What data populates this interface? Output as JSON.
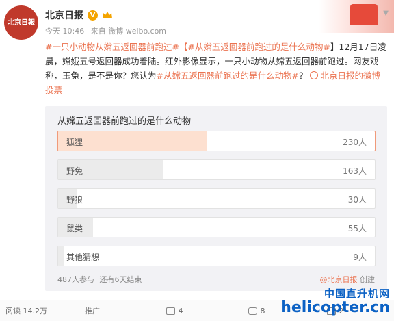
{
  "account": {
    "name": "北京日报",
    "avatar_text": "北京日報"
  },
  "meta": {
    "time": "今天 10:46",
    "source": "来自 微博 weibo.com"
  },
  "post": {
    "topic1": "#一只小动物从嫦五返回器前跑过#",
    "topic2": "【#从嫦五返回器前跑过的是什么动物#",
    "text1": "】12月17日凌晨，嫦娥五号返回器成功着陆。红外影像显示，一只小动物从嫦五返回器前跑过。网友戏称，玉兔，是不是你？您认为",
    "topic3": "#从嫦五返回器前跑过的是什么动物#",
    "text2": "？",
    "vote_link": "北京日报的微博投票"
  },
  "poll": {
    "title": "从嫦五返回器前跑过的是什么动物",
    "options": [
      {
        "label": "狐狸",
        "count": "230人",
        "share": 0.47
      },
      {
        "label": "野兔",
        "count": "163人",
        "share": 0.33
      },
      {
        "label": "野狼",
        "count": "30人",
        "share": 0.06
      },
      {
        "label": "鼠类",
        "count": "55人",
        "share": 0.11
      },
      {
        "label": "其他猜想",
        "count": "9人",
        "share": 0.02
      }
    ],
    "participants": "487人参与",
    "remaining": "还有6天结束",
    "creator": "@北京日报",
    "created": "创建"
  },
  "actions": {
    "read": "阅读 14.2万",
    "promote": "推广",
    "share": "4",
    "comment": "8",
    "like": "2"
  },
  "watermark": {
    "cn": "中国直升机网",
    "en": "helicopter.cn"
  },
  "colors": {
    "accent": "#eb7350",
    "selected_fill": "#fde0d0",
    "watermark": "#0b61c4"
  }
}
